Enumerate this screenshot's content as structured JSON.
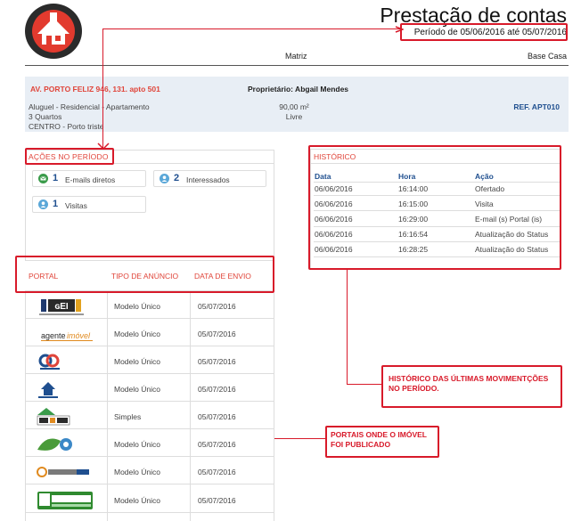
{
  "header": {
    "title": "Prestação de contas",
    "period": "Período de 05/06/2016 até 05/07/2016",
    "matriz": "Matriz",
    "brand": "Base Casa"
  },
  "property": {
    "address": "AV. PORTO FELIZ 946, 131. apto 501",
    "owner": "Proprietário: Abgail Mendes",
    "type": "Aluguel - Residencial - Apartamento",
    "rooms": "3 Quartos",
    "location": "CENTRO - Porto triste",
    "area": "90,00 m²",
    "status": "Livre",
    "ref": "REF. APT010"
  },
  "actions": {
    "title": "AÇÕES NO PERÍODO",
    "items": [
      {
        "count": "1",
        "label": "E-mails diretos",
        "icon": "email-icon",
        "color": "#3a9b4a"
      },
      {
        "count": "2",
        "label": "Interessados",
        "icon": "user-icon",
        "color": "#5aa7d8"
      },
      {
        "count": "1",
        "label": "Visitas",
        "icon": "user-icon",
        "color": "#5aa7d8"
      }
    ]
  },
  "history": {
    "title": "HISTÓRICO",
    "columns": [
      "Data",
      "Hora",
      "Ação"
    ],
    "rows": [
      [
        "06/06/2016",
        "16:14:00",
        "Ofertado"
      ],
      [
        "06/06/2016",
        "16:15:00",
        "Visita"
      ],
      [
        "06/06/2016",
        "16:29:00",
        "E-mail (s) Portal (is)"
      ],
      [
        "06/06/2016",
        "16:16:54",
        "Atualização do Status"
      ],
      [
        "06/06/2016",
        "16:28:25",
        "Atualização do Status"
      ]
    ]
  },
  "portals": {
    "columns": [
      "PORTAL",
      "TIPO DE ANÚNCIO",
      "DATA DE ENVIO"
    ],
    "rows": [
      {
        "logo": "tgei-logo",
        "type": "Modelo Único",
        "date": "05/07/2016"
      },
      {
        "logo": "agente-imovel-logo",
        "type": "Modelo Único",
        "date": "05/07/2016"
      },
      {
        "logo": "chave-logo",
        "type": "Modelo Único",
        "date": "05/07/2016"
      },
      {
        "logo": "house-logo",
        "type": "Modelo Único",
        "date": "05/07/2016"
      },
      {
        "logo": "casa-logo",
        "type": "Simples",
        "date": "05/07/2016"
      },
      {
        "logo": "aqui-logo",
        "type": "Modelo Único",
        "date": "05/07/2016"
      },
      {
        "logo": "imovel-casa-logo",
        "type": "Modelo Único",
        "date": "05/07/2016"
      },
      {
        "logo": "imoveis-logo",
        "type": "Modelo Único",
        "date": "05/07/2016"
      }
    ]
  },
  "annotations": {
    "history_note": "HISTÓRICO DAS ÚLTIMAS MOVIMENTÇÕES NO PERÍODO.",
    "portal_note": "PORTAIS ONDE O IMÓVEL FOI PUBLICADO"
  },
  "colors": {
    "accent": "#e0453a",
    "link": "#1f4f8f",
    "annotation": "#d81a2a",
    "band": "#e8eef5"
  }
}
